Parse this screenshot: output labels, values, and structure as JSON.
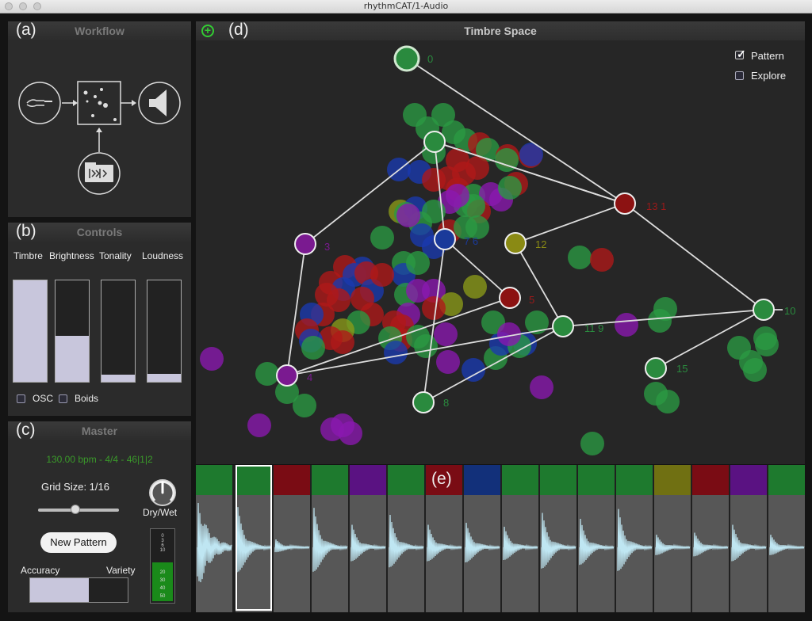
{
  "window": {
    "title": "rhythmCAT/1-Audio"
  },
  "workflow": {
    "letter": "(a)",
    "title": "Workflow"
  },
  "controls": {
    "letter": "(b)",
    "title": "Controls",
    "sliders": [
      {
        "label": "Timbre",
        "value": 1.0
      },
      {
        "label": "Brightness",
        "value": 0.45
      },
      {
        "label": "Tonality",
        "value": 0.07
      },
      {
        "label": "Loudness",
        "value": 0.08
      }
    ],
    "osc_label": "OSC",
    "osc_checked": false,
    "boids_label": "Boids",
    "boids_checked": false
  },
  "master": {
    "letter": "(c)",
    "title": "Master",
    "status": "130.00 bpm - 4/4 - 46|1|2",
    "grid_size_label": "Grid Size: 1/16",
    "grid_size_value": 0.45,
    "dry_wet_label": "Dry/Wet",
    "dry_wet_value": 0.5,
    "new_pattern_label": "New Pattern",
    "accuracy_label": "Accuracy",
    "variety_label": "Variety",
    "accuracy_variety_value": 0.6,
    "meter_ticks": [
      "0",
      "3",
      "6",
      "10",
      "20",
      "30",
      "40",
      "50"
    ],
    "meter_level": 0.55
  },
  "timbre_space": {
    "letter": "(d)",
    "title": "Timbre Space",
    "pattern_label": "Pattern",
    "pattern_checked": true,
    "explore_label": "Explore",
    "explore_checked": false,
    "nodes": [
      {
        "label": "0",
        "color": "#2a8a3e"
      },
      {
        "label": "13 1",
        "color": "#8c1212"
      },
      {
        "label": "12",
        "color": "#8a8a14"
      },
      {
        "label": "3",
        "color": "#7a1a90"
      },
      {
        "label": "7 6",
        "color": "#1a3a9a"
      },
      {
        "label": "5",
        "color": "#8c1212"
      },
      {
        "label": "11 9",
        "color": "#2a8a3e"
      },
      {
        "label": "10",
        "color": "#2a8a3e"
      },
      {
        "label": "15",
        "color": "#2a8a3e"
      },
      {
        "label": "4",
        "color": "#7a1a90"
      },
      {
        "label": "8",
        "color": "#2a8a3e"
      }
    ]
  },
  "sequencer": {
    "letter": "(e)",
    "colors": {
      "green": "#1e7a2e",
      "red": "#7a0c14",
      "purple": "#5a1282",
      "blue": "#12307a",
      "olive": "#707012"
    },
    "steps": [
      {
        "color": "#1e7a2e",
        "amp": 1.0
      },
      {
        "color": "#7a0c14",
        "amp": 0.18
      },
      {
        "color": "#1e7a2e",
        "amp": 0.98
      },
      {
        "color": "#5a1282",
        "amp": 0.55
      },
      {
        "color": "#1e7a2e",
        "amp": 0.8
      },
      {
        "color": "#7a0c14",
        "amp": 0.55
      },
      {
        "color": "#12307a",
        "amp": 0.6
      },
      {
        "color": "#1e7a2e",
        "amp": 0.5
      },
      {
        "color": "#1e7a2e",
        "amp": 0.85
      },
      {
        "color": "#1e7a2e",
        "amp": 0.7
      },
      {
        "color": "#1e7a2e",
        "amp": 0.95
      },
      {
        "color": "#707012",
        "amp": 0.3
      },
      {
        "color": "#7a0c14",
        "amp": 0.35
      },
      {
        "color": "#5a1282",
        "amp": 0.55
      },
      {
        "color": "#1e7a2e",
        "amp": 0.3
      }
    ],
    "selected_step": 1
  }
}
